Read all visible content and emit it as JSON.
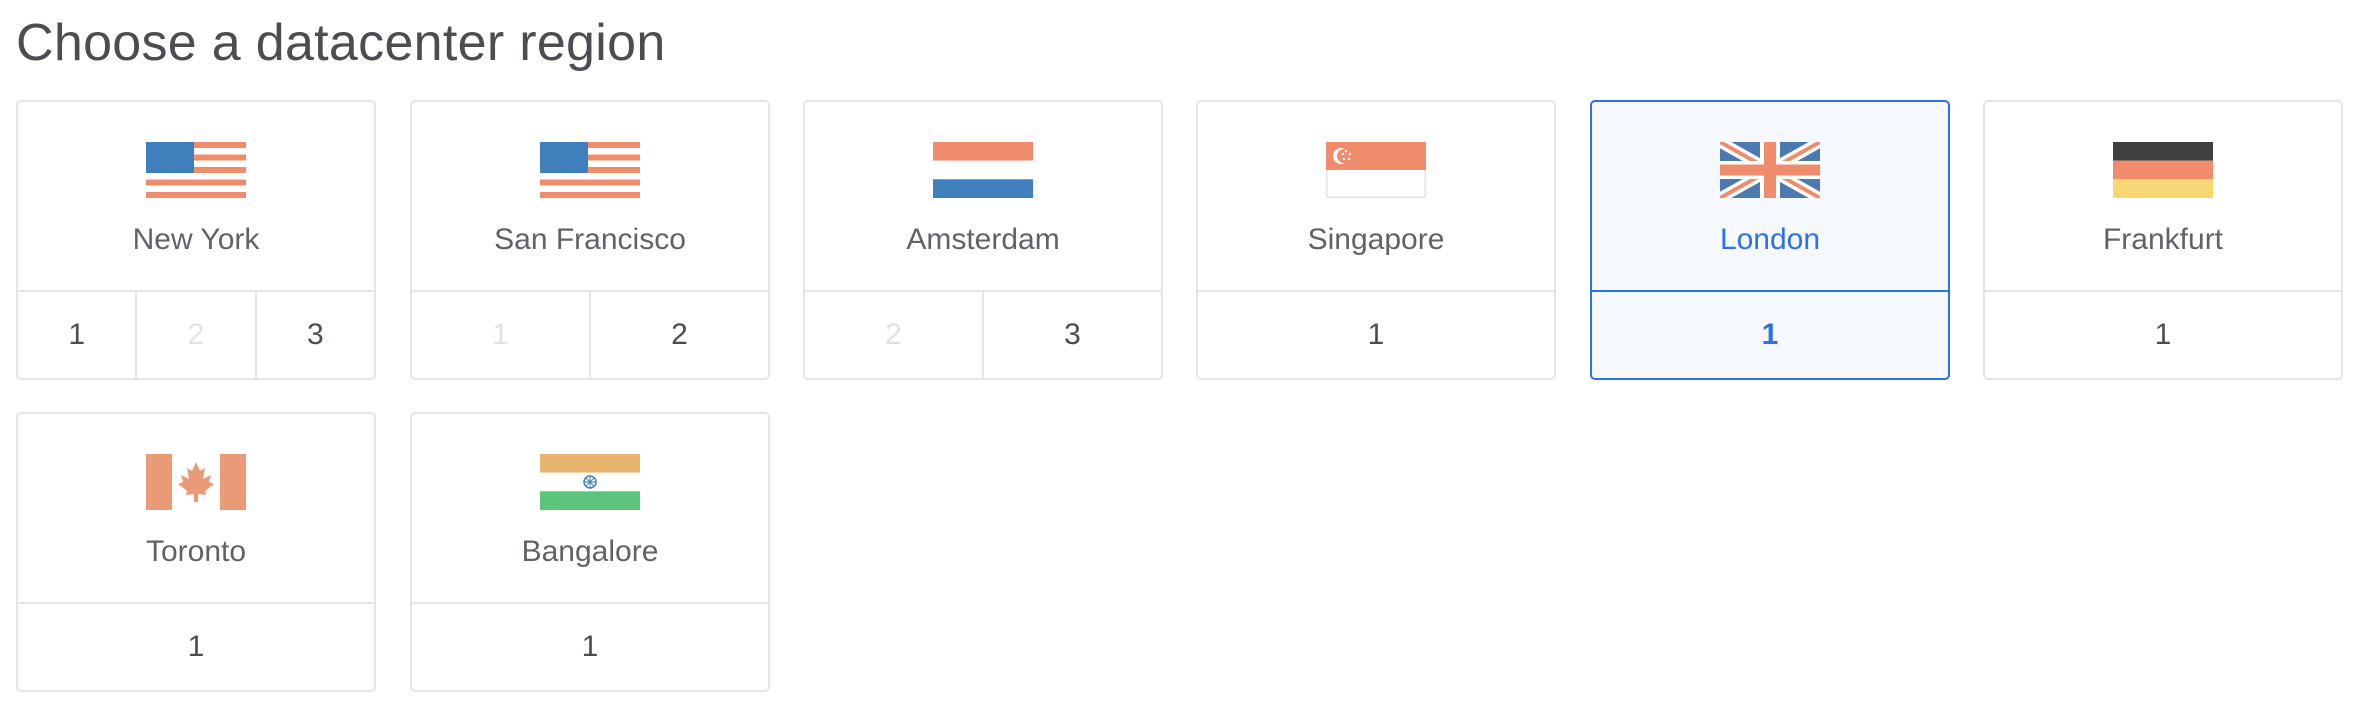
{
  "page": {
    "title": "Choose a datacenter region"
  },
  "colors": {
    "selected_accent": "#2a72e5",
    "border": "#e3e5e8",
    "disabled_text": "#dfe2e5"
  },
  "regions": [
    {
      "city": "New York",
      "flag_icon": "us-flag-icon",
      "datacenters": [
        {
          "label": "1",
          "enabled": true
        },
        {
          "label": "2",
          "enabled": false
        },
        {
          "label": "3",
          "enabled": true
        }
      ],
      "selected": false
    },
    {
      "city": "San Francisco",
      "flag_icon": "us-flag-icon",
      "datacenters": [
        {
          "label": "1",
          "enabled": false
        },
        {
          "label": "2",
          "enabled": true
        }
      ],
      "selected": false
    },
    {
      "city": "Amsterdam",
      "flag_icon": "netherlands-flag-icon",
      "datacenters": [
        {
          "label": "2",
          "enabled": false
        },
        {
          "label": "3",
          "enabled": true
        }
      ],
      "selected": false
    },
    {
      "city": "Singapore",
      "flag_icon": "singapore-flag-icon",
      "datacenters": [
        {
          "label": "1",
          "enabled": true
        }
      ],
      "selected": false
    },
    {
      "city": "London",
      "flag_icon": "uk-flag-icon",
      "datacenters": [
        {
          "label": "1",
          "enabled": true
        }
      ],
      "selected": true
    },
    {
      "city": "Frankfurt",
      "flag_icon": "germany-flag-icon",
      "datacenters": [
        {
          "label": "1",
          "enabled": true
        }
      ],
      "selected": false
    },
    {
      "city": "Toronto",
      "flag_icon": "canada-flag-icon",
      "datacenters": [
        {
          "label": "1",
          "enabled": true
        }
      ],
      "selected": false
    },
    {
      "city": "Bangalore",
      "flag_icon": "india-flag-icon",
      "datacenters": [
        {
          "label": "1",
          "enabled": true
        }
      ],
      "selected": false
    }
  ]
}
